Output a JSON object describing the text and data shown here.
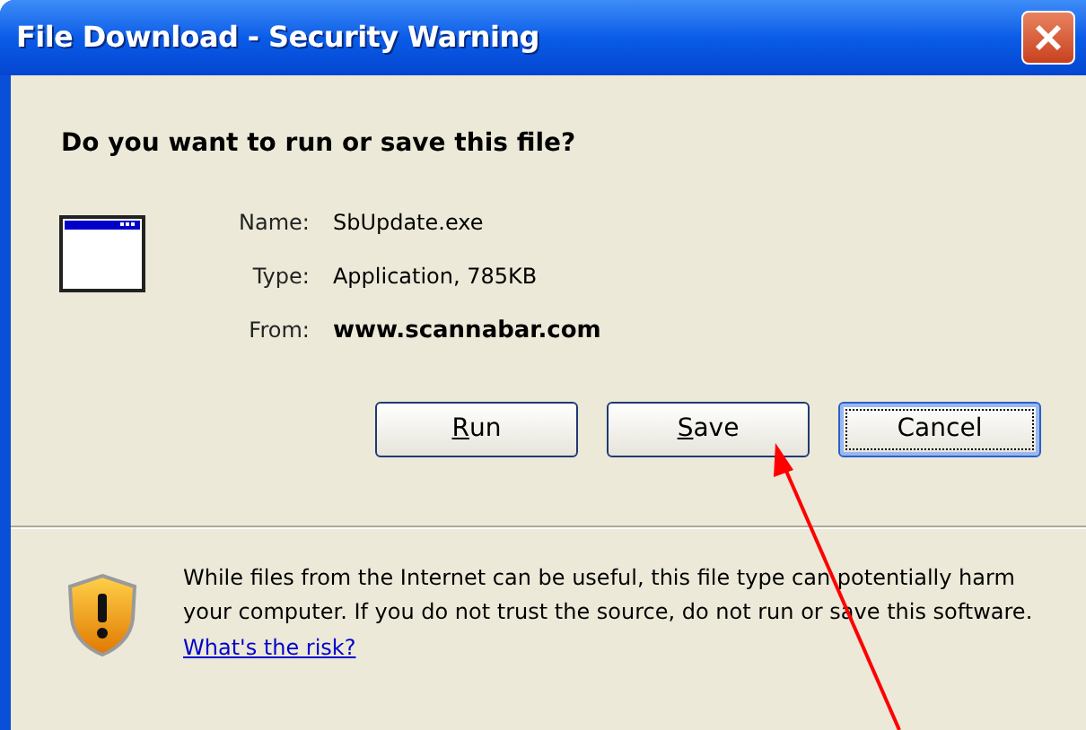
{
  "window": {
    "title": "File Download - Security Warning"
  },
  "question": "Do you want to run or save this file?",
  "details": [
    {
      "label": "Name:",
      "value": "SbUpdate.exe",
      "bold": false
    },
    {
      "label": "Type:",
      "value": "Application, 785KB",
      "bold": false
    },
    {
      "label": "From:",
      "value": "www.scannabar.com",
      "bold": true
    }
  ],
  "buttons": [
    {
      "label": "Run",
      "mnemonic_first": true,
      "focused": false
    },
    {
      "label": "Save",
      "mnemonic_first": true,
      "focused": false
    },
    {
      "label": "Cancel",
      "mnemonic_first": false,
      "focused": true
    }
  ],
  "warning": {
    "text": "While files from the Internet can be useful, this file type can potentially harm your computer. If you do not trust the source, do not run or save this software.",
    "link": "What's the risk?"
  }
}
